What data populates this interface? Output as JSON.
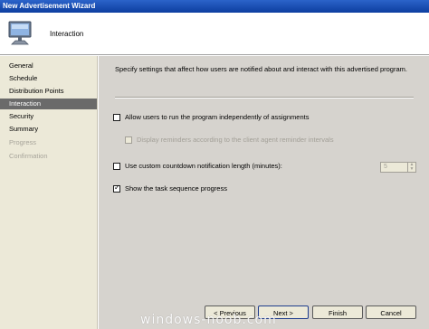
{
  "window": {
    "title": "New Advertisement Wizard"
  },
  "banner": {
    "title": "Interaction",
    "icon": "computer-monitor-icon"
  },
  "nav": {
    "items": [
      {
        "label": "General",
        "state": "normal"
      },
      {
        "label": "Schedule",
        "state": "normal"
      },
      {
        "label": "Distribution Points",
        "state": "normal"
      },
      {
        "label": "Interaction",
        "state": "selected"
      },
      {
        "label": "Security",
        "state": "normal"
      },
      {
        "label": "Summary",
        "state": "normal"
      },
      {
        "label": "Progress",
        "state": "disabled"
      },
      {
        "label": "Confirmation",
        "state": "disabled"
      }
    ]
  },
  "main": {
    "intro": "Specify settings that affect how users are notified about and interact with this advertised program.",
    "options": {
      "allow_independent": {
        "label": "Allow users to run the program independently of assignments",
        "checked": false
      },
      "display_reminders": {
        "label": "Display reminders according to the client agent reminder intervals",
        "checked": false,
        "enabled": false
      },
      "custom_countdown": {
        "label": "Use custom countdown notification length (minutes):",
        "checked": false
      },
      "countdown_value": "5",
      "show_progress": {
        "label": "Show the task sequence progress",
        "checked": true
      }
    }
  },
  "buttons": {
    "previous": "< Previous",
    "next": "Next >",
    "finish": "Finish",
    "cancel": "Cancel"
  },
  "watermark": "windows-noob.com",
  "colors": {
    "titlebar": "#0d3ea0",
    "nav_background": "#ece9d8",
    "nav_selected": "#6a6a6a",
    "content_background": "#d6d3ce"
  }
}
